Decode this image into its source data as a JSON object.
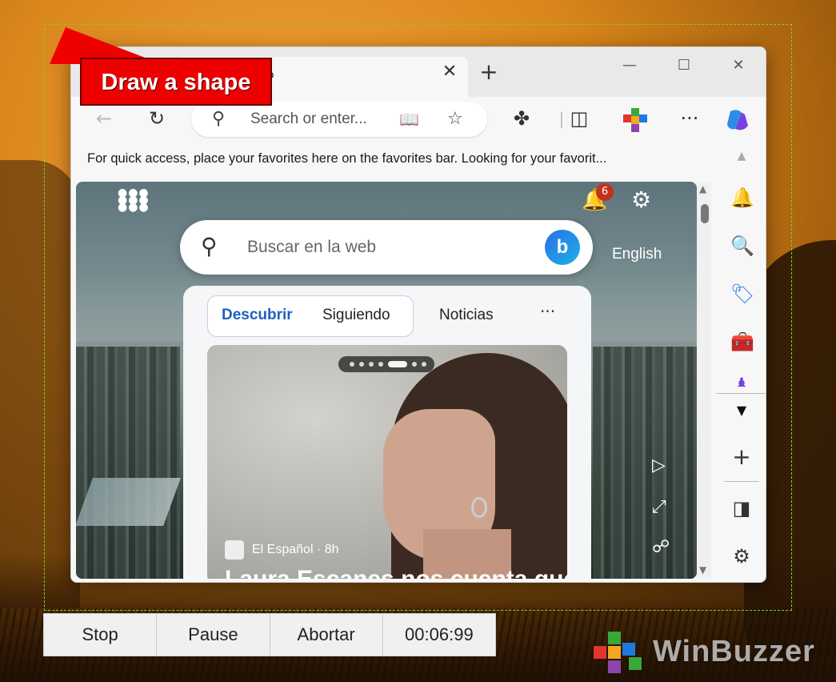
{
  "callout": {
    "label": "Draw a shape"
  },
  "browser": {
    "tab": {
      "title": "o",
      "close_glyph": "✕"
    },
    "new_tab_glyph": "+",
    "window_buttons": {
      "minimize": "—",
      "maximize": "☐",
      "close": "✕"
    },
    "toolbar": {
      "back_glyph": "←",
      "refresh_glyph": "↻",
      "address_placeholder": "Search or enter...",
      "more_glyph": "···"
    },
    "favorites_bar_text": "For quick access, place your favorites here on the favorites bar. Looking for your favorit..."
  },
  "newtab": {
    "notification_count": "6",
    "search_placeholder": "Buscar en la web",
    "language_link": "English",
    "feed_tabs": [
      "Descubrir",
      "Siguiendo",
      "Noticias"
    ],
    "feed_more": "···",
    "article": {
      "source": "El Español · 8h",
      "headline": "Laura Escanes nos cuenta qué"
    }
  },
  "controls": {
    "stop": "Stop",
    "pause": "Pause",
    "abort": "Abortar",
    "timer": "00:06:99"
  },
  "watermark": {
    "text": "WinBuzzer"
  },
  "colors": {
    "accent_red": "#e00000",
    "capture_border": "#7ed321",
    "link_blue": "#1f5fbf"
  }
}
